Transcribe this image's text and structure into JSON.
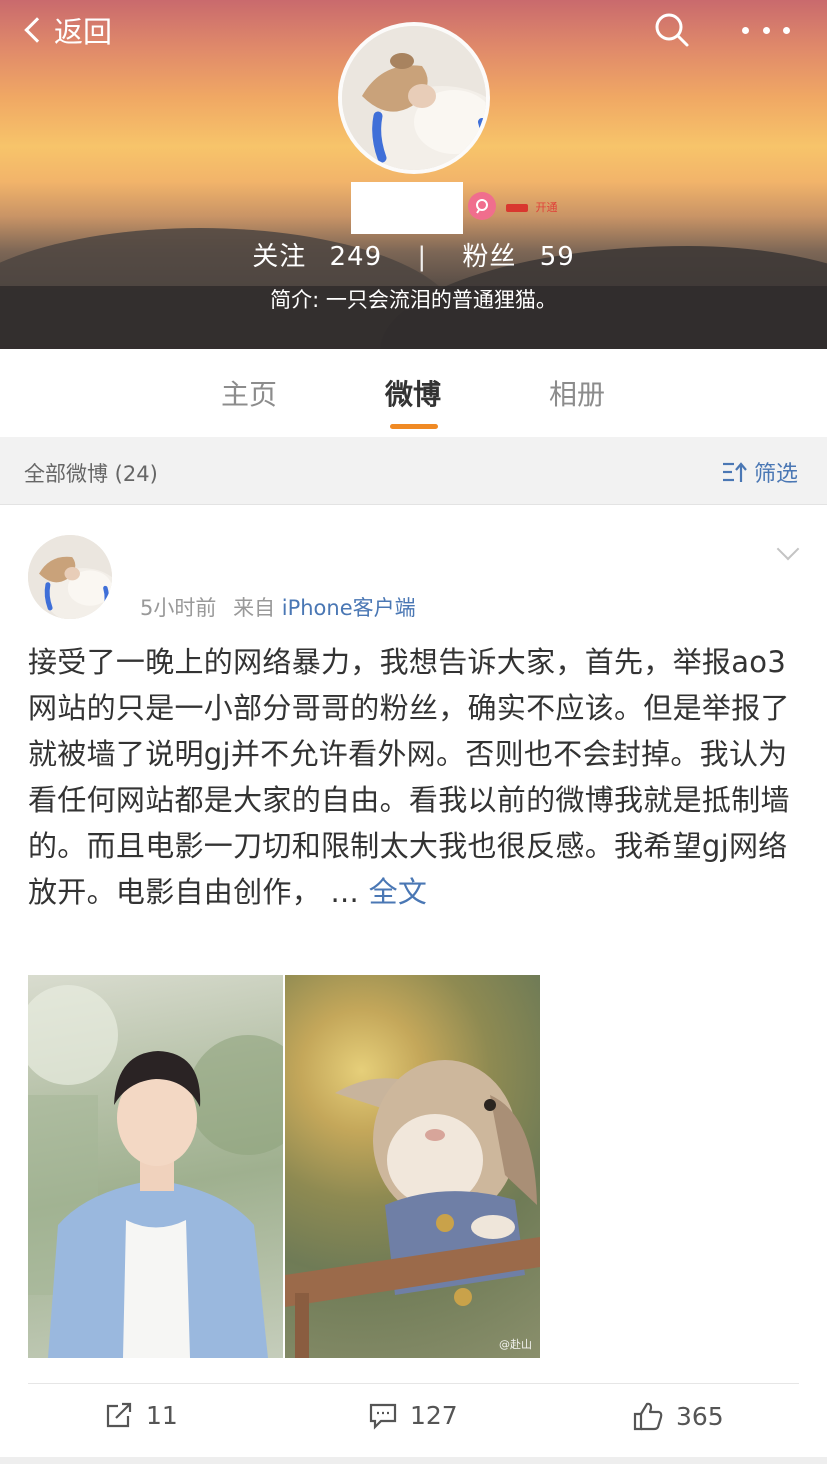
{
  "header": {
    "back_label": "返回",
    "vip_badge": "开通",
    "stats": {
      "following_label": "关注",
      "following_count": "249",
      "separator": "|",
      "followers_label": "粉丝",
      "followers_count": "59"
    },
    "bio": "简介: 一只会流泪的普通狸猫。"
  },
  "tabs": [
    {
      "label": "主页",
      "active": false
    },
    {
      "label": "微博",
      "active": true
    },
    {
      "label": "相册",
      "active": false
    }
  ],
  "filterbar": {
    "count_label": "全部微博 (24)",
    "filter_label": "筛选"
  },
  "post": {
    "time": "5小时前",
    "source_prefix": "来自",
    "source": "iPhone客户端",
    "text": "接受了一晚上的网络暴力，我想告诉大家，首先，举报ao3网站的只是一小部分哥哥的粉丝，确实不应该。但是举报了就被墙了说明gj并不允许看外网。否则也不会封掉。我认为看任何网站都是大家的自由。看我以前的微博我就是抵制墙的。而且电影一刀切和限制太大我也很反感。我希望gj网络放开。电影自由创作， ... ",
    "full_text_link": "全文",
    "image_watermark": "@赴山",
    "actions": {
      "repost_count": "11",
      "comment_count": "127",
      "like_count": "365"
    }
  },
  "icons": {
    "back": "chevron-left-icon",
    "search": "search-icon",
    "more": "more-dots-icon",
    "vip": "vip-icon",
    "filter": "filter-icon",
    "expand": "chevron-down-icon",
    "repost": "repost-icon",
    "comment": "comment-icon",
    "like": "like-icon"
  },
  "colors": {
    "accent_orange": "#f08a24",
    "link_blue": "#4a77b4",
    "vip_pink": "#f06e8d"
  }
}
